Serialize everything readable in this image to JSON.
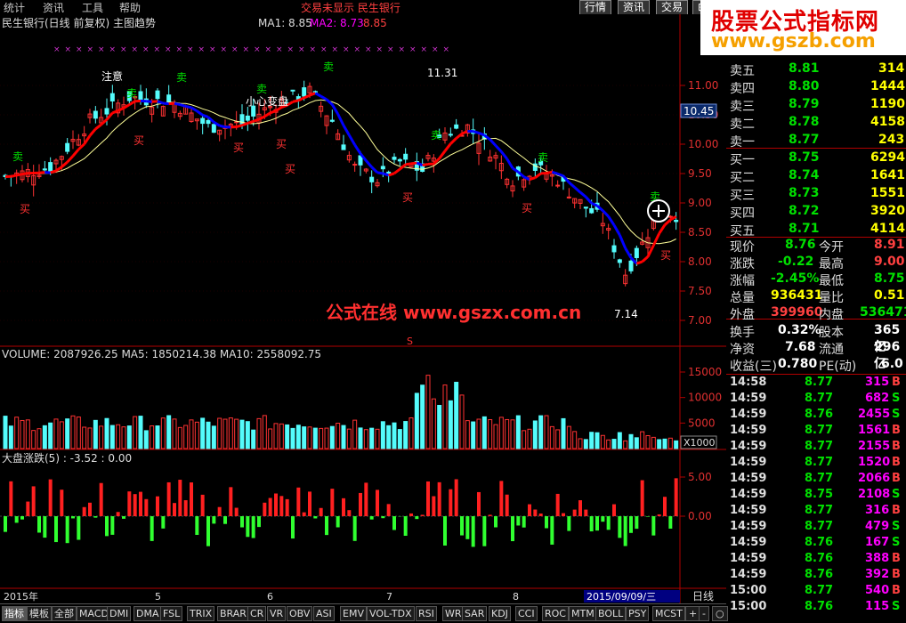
{
  "menu": [
    "统计",
    "资讯",
    "工具",
    "帮助"
  ],
  "menu_top_ticker": "交易未显示  民生银行",
  "right_tabs": [
    "行情",
    "资讯",
    "交易",
    "⊞"
  ],
  "watermark_gszb": {
    "line1": "股票公式指标网",
    "line2": "www.gszb.com"
  },
  "main_title": "民生银行(日线 前复权) 主图趋势",
  "ma_title": {
    "ma1": "MA1: 8.85",
    "ma2": "MA2: 8.73",
    "ma3": "8.85"
  },
  "watermark_gszx": "公式在线 www.gszx.com.cn",
  "price_axis": [
    "11.00",
    "10.50",
    "10.00",
    "9.50",
    "9.00",
    "8.50",
    "8.00",
    "7.50",
    "7.00"
  ],
  "current_price_tag": "10.45",
  "price_annotations": {
    "high": "11.31",
    "low": "7.14"
  },
  "signal_labels": {
    "buy": "买",
    "sell": "卖",
    "caution": "注意",
    "careful": "小心变盘",
    "s_marker": "S"
  },
  "volume_title": "VOLUME: 2087926.25  MA5: 1850214.38  MA10: 2558092.75",
  "volume_axis": [
    "15000",
    "10000",
    "5000"
  ],
  "volume_unit": "X1000",
  "osc_title": "大盘涨跌(5) : -3.52     : 0.00",
  "osc_axis": [
    "5.00",
    "0.00"
  ],
  "time_axis": [
    "2015年",
    "5",
    "6",
    "7",
    "8",
    "2015/09/09/三"
  ],
  "timeframe": "日线",
  "right_controls": [
    "+",
    "-",
    "○"
  ],
  "quote": {
    "asks": [
      {
        "label": "卖五",
        "price": "8.81",
        "vol": "314"
      },
      {
        "label": "卖四",
        "price": "8.80",
        "vol": "1444"
      },
      {
        "label": "卖三",
        "price": "8.79",
        "vol": "1190"
      },
      {
        "label": "卖二",
        "price": "8.78",
        "vol": "4158"
      },
      {
        "label": "卖一",
        "price": "8.77",
        "vol": "243"
      }
    ],
    "bids": [
      {
        "label": "买一",
        "price": "8.75",
        "vol": "6294"
      },
      {
        "label": "买二",
        "price": "8.74",
        "vol": "1641"
      },
      {
        "label": "买三",
        "price": "8.73",
        "vol": "1551"
      },
      {
        "label": "买四",
        "price": "8.72",
        "vol": "3920"
      },
      {
        "label": "买五",
        "price": "8.71",
        "vol": "4114"
      }
    ],
    "stats": [
      {
        "l1": "现价",
        "v1": "8.76",
        "l2": "今开",
        "v2": "8.91"
      },
      {
        "l1": "涨跌",
        "v1": "-0.22",
        "l2": "最高",
        "v2": "9.00"
      },
      {
        "l1": "涨幅",
        "v1": "-2.45%",
        "l2": "最低",
        "v2": "8.75"
      },
      {
        "l1": "总量",
        "v1": "936431",
        "l2": "量比",
        "v2": "0.51"
      },
      {
        "l1": "外盘",
        "v1": "399960",
        "l2": "内盘",
        "v2": "536471"
      }
    ],
    "stats2": [
      {
        "l1": "换手",
        "v1": "0.32%",
        "l2": "股本",
        "v2": "365亿"
      },
      {
        "l1": "净资",
        "v1": "7.68",
        "l2": "流通",
        "v2": "296亿"
      },
      {
        "l1": "收益(三)",
        "v1": "0.780",
        "l2": "PE(动)",
        "v2": "6.0"
      }
    ],
    "ticks": [
      {
        "t": "14:58",
        "p": "8.77",
        "v": "315",
        "s": "B"
      },
      {
        "t": "14:59",
        "p": "8.77",
        "v": "682",
        "s": "S"
      },
      {
        "t": "14:59",
        "p": "8.76",
        "v": "2455",
        "s": "S"
      },
      {
        "t": "14:59",
        "p": "8.77",
        "v": "1561",
        "s": "B"
      },
      {
        "t": "14:59",
        "p": "8.77",
        "v": "2155",
        "s": "B"
      },
      {
        "t": "14:59",
        "p": "8.77",
        "v": "1520",
        "s": "B"
      },
      {
        "t": "14:59",
        "p": "8.77",
        "v": "2066",
        "s": "B"
      },
      {
        "t": "14:59",
        "p": "8.75",
        "v": "2108",
        "s": "S"
      },
      {
        "t": "14:59",
        "p": "8.77",
        "v": "316",
        "s": "B"
      },
      {
        "t": "14:59",
        "p": "8.77",
        "v": "479",
        "s": "S"
      },
      {
        "t": "14:59",
        "p": "8.76",
        "v": "167",
        "s": "S"
      },
      {
        "t": "14:59",
        "p": "8.76",
        "v": "388",
        "s": "B"
      },
      {
        "t": "14:59",
        "p": "8.76",
        "v": "392",
        "s": "B"
      },
      {
        "t": "15:00",
        "p": "8.77",
        "v": "540",
        "s": "B"
      },
      {
        "t": "15:00",
        "p": "8.76",
        "v": "115",
        "s": "S"
      }
    ]
  },
  "bottom_tabs": [
    "指标",
    "模板",
    "全部",
    "MACD",
    "DMI",
    "DMA",
    "FSL",
    "TRIX",
    "BRAR",
    "CR",
    "VR",
    "OBV",
    "ASI",
    "EMV",
    "VOL-TDX",
    "RSI",
    "WR",
    "SAR",
    "KDJ",
    "CCI",
    "ROC",
    "MTM",
    "BOLL",
    "PSY",
    "MCST"
  ],
  "colors": {
    "up": "#ff3232",
    "down": "#54fcfc",
    "trend_up": "#ff0000",
    "trend_down": "#0000ff",
    "ma_yellow": "#ffff99",
    "buy_label": "#ff3232",
    "sell_label": "#00e000"
  }
}
